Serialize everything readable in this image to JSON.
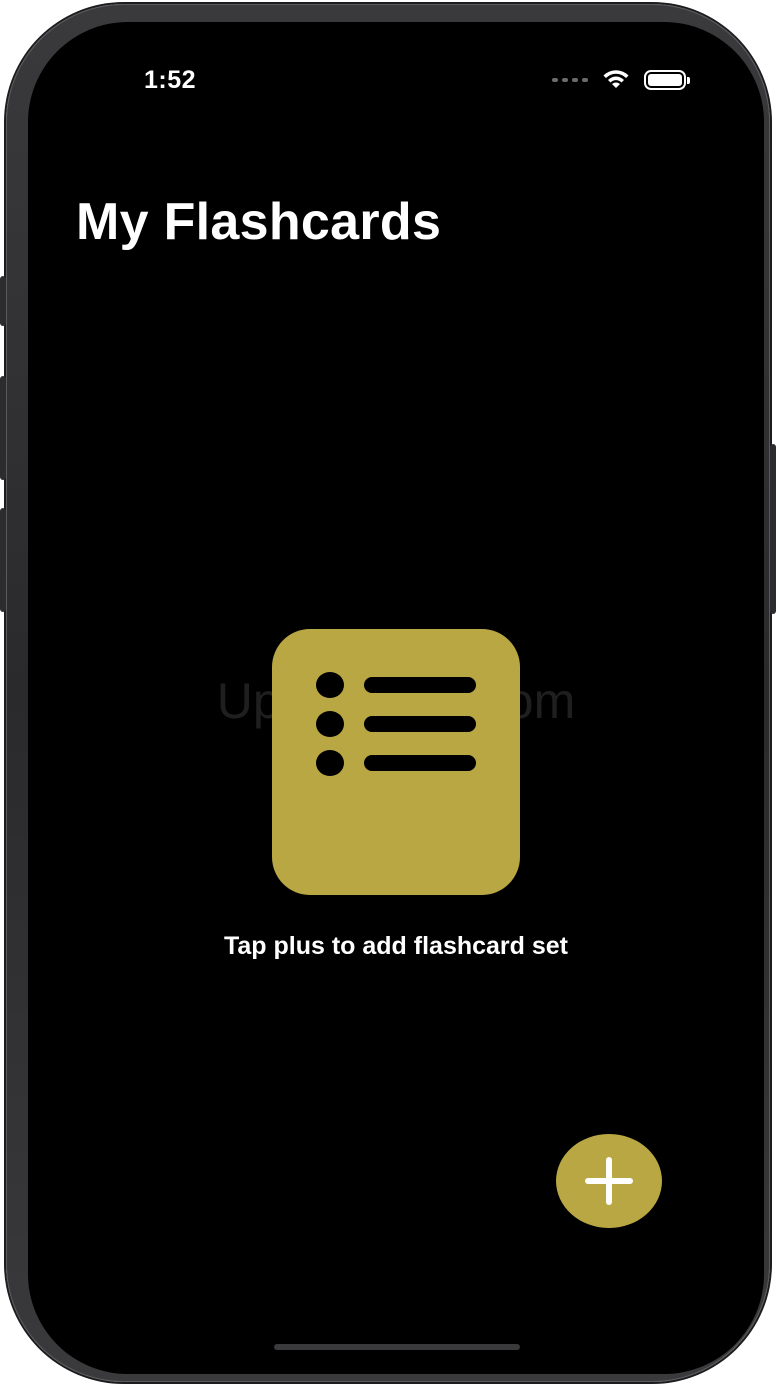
{
  "status_bar": {
    "time": "1:52",
    "wifi_icon": "wifi-icon",
    "battery_icon": "battery-icon",
    "battery_level": 1.0
  },
  "header": {
    "title": "My Flashcards"
  },
  "empty_state": {
    "icon": "list-icon",
    "message": "Tap plus to add flashcard set"
  },
  "add_button": {
    "icon": "plus-icon"
  },
  "watermark": {
    "text": "UpdateStar.com"
  },
  "colors": {
    "accent": "#b9a744",
    "background": "#000000",
    "text": "#ffffff"
  }
}
